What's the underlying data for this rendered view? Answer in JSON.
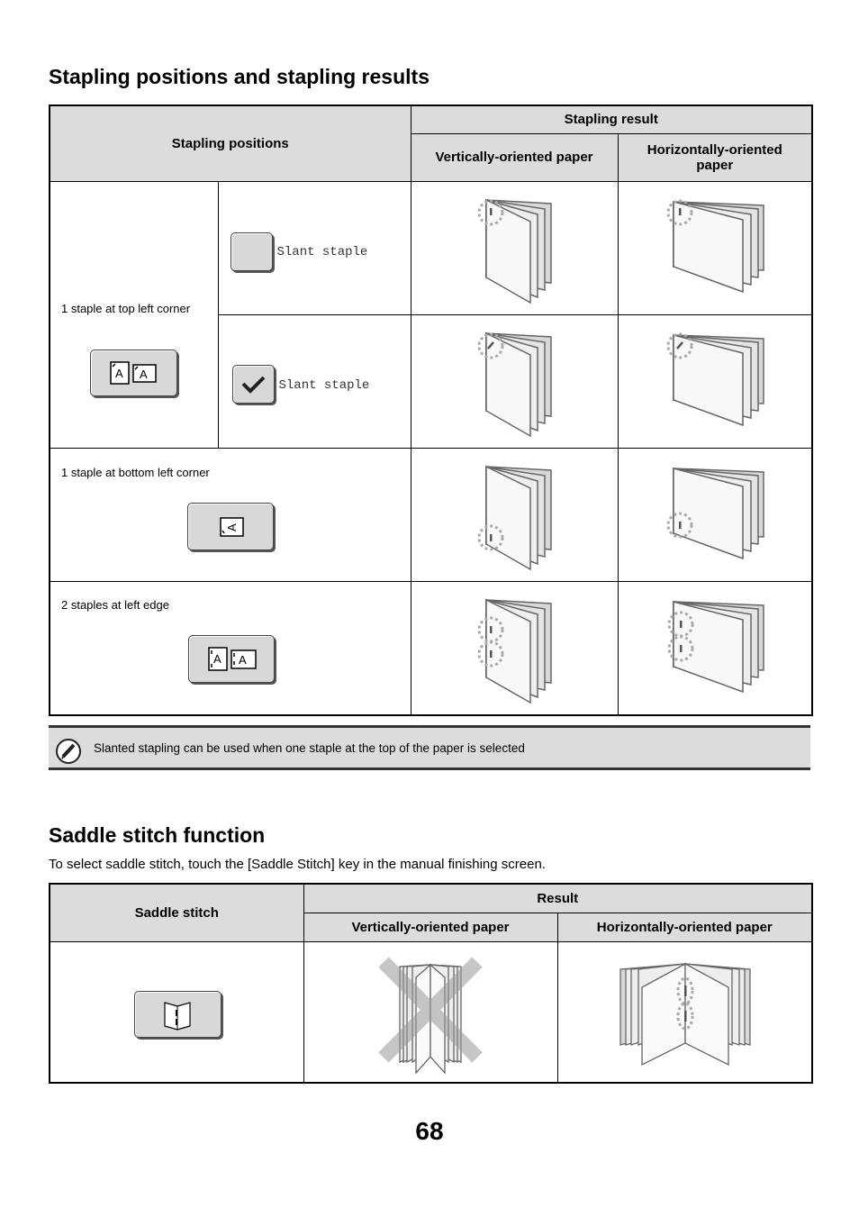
{
  "section1": {
    "title": "Stapling positions and stapling results",
    "table": {
      "header_positions": "Stapling positions",
      "header_result": "Stapling result",
      "header_vertical": "Vertically-oriented paper",
      "header_horizontal": "Horizontally-oriented paper",
      "rows": [
        {
          "label": "1 staple at top left corner",
          "button_icon": "staple-top-left-icon",
          "options": [
            {
              "checkbox_checked": false,
              "label": "Slant staple"
            },
            {
              "checkbox_checked": true,
              "label": "Slant staple"
            }
          ]
        },
        {
          "label": "1 staple at bottom left corner",
          "button_icon": "staple-bottom-left-icon"
        },
        {
          "label": "2 staples at left edge",
          "button_icon": "staple-two-left-icon"
        }
      ]
    }
  },
  "note": {
    "icon": "pencil-note-icon",
    "text": "Slanted stapling can be used when one staple at the top of the paper is selected"
  },
  "section2": {
    "title": "Saddle stitch function",
    "intro": "To select saddle stitch, touch the [Saddle Stitch] key in the manual finishing screen.",
    "table": {
      "header_saddle": "Saddle stitch",
      "header_result": "Result",
      "header_vertical": "Vertically-oriented paper",
      "header_horizontal": "Horizontally-oriented paper",
      "vertical_allowed": false,
      "horizontal_allowed": true
    }
  },
  "page_number": "68"
}
